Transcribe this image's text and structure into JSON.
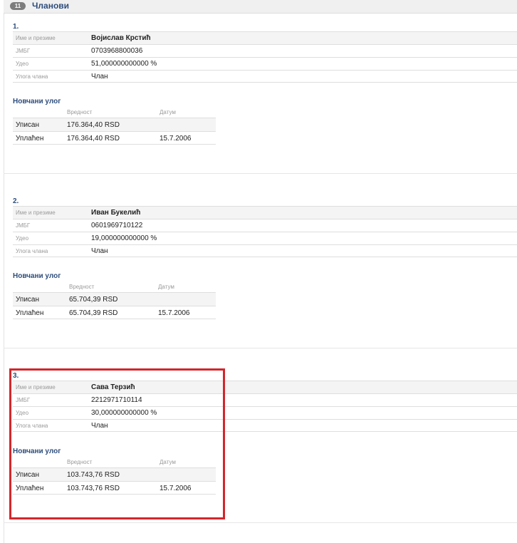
{
  "section": {
    "badge": "11",
    "title": "Чланови"
  },
  "labels": {
    "name": "Име и презиме",
    "jmbg": "ЈМБГ",
    "share": "Удео",
    "role": "Улога члана",
    "money_title": "Новчани улог",
    "value_col": "Вредност",
    "date_col": "Датум",
    "subscribed": "Уписан",
    "paid": "Уплаћен"
  },
  "members": [
    {
      "num": "1.",
      "name": "Војислав Крстић",
      "jmbg": "0703968800036",
      "share": "51,000000000000 %",
      "role": "Члан",
      "subscribed_value": "176.364,40 RSD",
      "paid_value": "176.364,40 RSD",
      "paid_date": "15.7.2006"
    },
    {
      "num": "2.",
      "name": "Иван Букелић",
      "jmbg": "0601969710122",
      "share": "19,000000000000 %",
      "role": "Члан",
      "subscribed_value": "65.704,39 RSD",
      "paid_value": "65.704,39 RSD",
      "paid_date": "15.7.2006"
    },
    {
      "num": "3.",
      "name": "Сава Терзић",
      "jmbg": "2212971710114",
      "share": "30,000000000000 %",
      "role": "Члан",
      "subscribed_value": "103.743,76 RSD",
      "paid_value": "103.743,76 RSD",
      "paid_date": "15.7.2006"
    }
  ],
  "highlight_color": "#d3262c"
}
